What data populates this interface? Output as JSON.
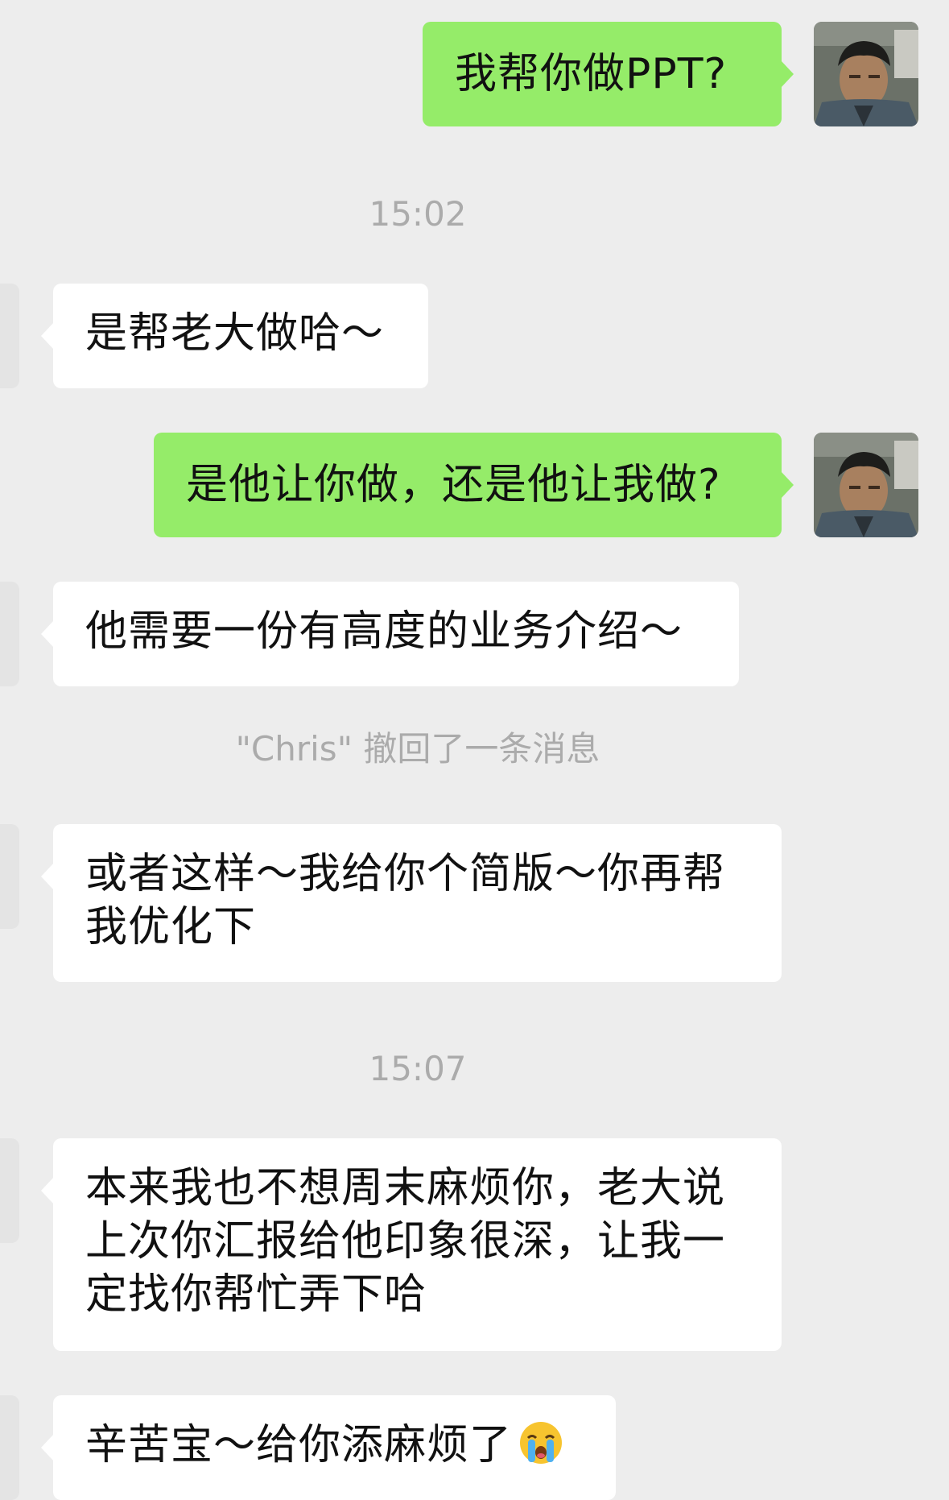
{
  "chat": {
    "messages": [
      {
        "side": "out",
        "text": "我帮你做PPT?"
      },
      {
        "side": "time",
        "text": "15:02"
      },
      {
        "side": "in",
        "text": "是帮老大做哈～"
      },
      {
        "side": "out",
        "text": "是他让你做，还是他让我做?"
      },
      {
        "side": "in",
        "text": "他需要一份有高度的业务介绍～"
      },
      {
        "side": "system",
        "text": "\"Chris\" 撤回了一条消息"
      },
      {
        "side": "in",
        "text": "或者这样～我给你个简版～你再帮我优化下"
      },
      {
        "side": "time",
        "text": "15:07"
      },
      {
        "side": "in",
        "text": "本来我也不想周末麻烦你，老大说上次你汇报给他印象很深，让我一定找你帮忙弄下哈"
      },
      {
        "side": "in",
        "text": "辛苦宝～给你添麻烦了",
        "emoji": "loudly-crying-face"
      }
    ]
  },
  "colors": {
    "background": "#ededed",
    "outgoing_bubble": "#95ec69",
    "incoming_bubble": "#ffffff",
    "system_text": "#ababab"
  }
}
